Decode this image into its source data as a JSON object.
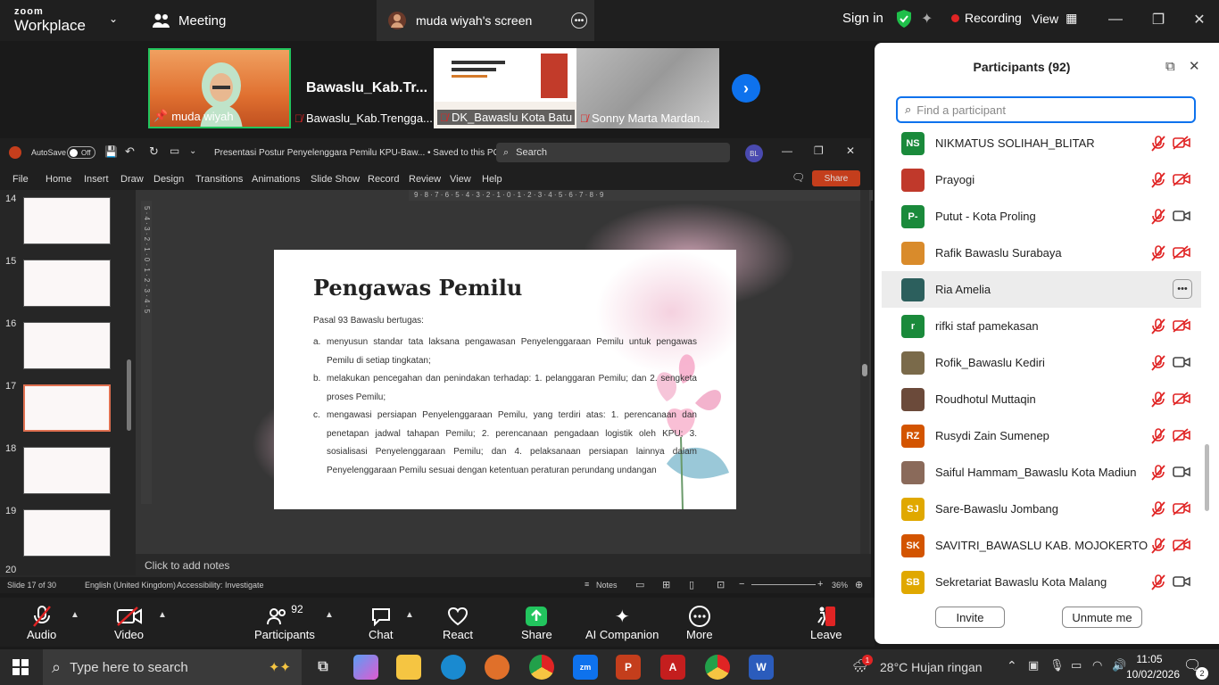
{
  "zoom": {
    "logo_top": "zoom",
    "logo_bottom": "Workplace",
    "meeting_tab": "Meeting",
    "screen_tab": "muda wiyah's screen",
    "sign_in": "Sign in",
    "recording": "Recording",
    "view": "View"
  },
  "video_tiles": [
    {
      "name": "muda wiyah"
    },
    {
      "name": "Bawaslu_Kab.Trengga...",
      "display_title": "Bawaslu_Kab.Tr..."
    },
    {
      "name": "DK_Bawaslu Kota Batu"
    },
    {
      "name": "Sonny Marta Mardan..."
    }
  ],
  "ppt": {
    "autosave_label": "AutoSave",
    "autosave_state": "Off",
    "title": "Presentasi Postur Penyelenggara Pemilu KPU-Baw... • Saved to this PC",
    "search_placeholder": "Search",
    "user_initials": "BL",
    "share_label": "Share",
    "menu": [
      "File",
      "Home",
      "Insert",
      "Draw",
      "Design",
      "Transitions",
      "Animations",
      "Slide Show",
      "Record",
      "Review",
      "View",
      "Help"
    ],
    "thumb_numbers": [
      "14",
      "15",
      "16",
      "17",
      "18",
      "19",
      "20"
    ],
    "ruler_top": "9 · 8 · 7 · 6 · 5 · 4 · 3 · 2 · 1 · 0 · 1 · 2 · 3 · 4 · 5 · 6 · 7 · 8 · 9",
    "ruler_left": "5 · 4 · 3 · 2 · 1 · 0 · 1 · 2 · 3 · 4 · 5",
    "notes_placeholder": "Click to add notes",
    "status_slide": "Slide 17 of 30",
    "status_lang": "English (United Kingdom)",
    "status_access": "Accessibility: Investigate",
    "status_notes": "Notes",
    "status_zoom": "36%"
  },
  "slide": {
    "title": "Pengawas Pemilu",
    "intro": "Pasal 93 Bawaslu bertugas:",
    "items": [
      {
        "marker": "a.",
        "text": "menyusun standar tata laksana pengawasan Penyelenggaraan Pemilu untuk pengawas Pemilu di setiap tingkatan;"
      },
      {
        "marker": "b.",
        "text": "melakukan pencegahan dan penindakan terhadap: 1. pelanggaran Pemilu; dan 2. sengketa proses Pemilu;"
      },
      {
        "marker": "c.",
        "text": "mengawasi persiapan Penyelenggaraan Pemilu, yang terdiri atas: 1. perencanaan dan penetapan jadwal tahapan Pemilu; 2. perencanaan pengadaan logistik oleh KPU; 3. sosialisasi Penyelenggaraan Pemilu; dan 4. pelaksanaan persiapan lainnya dalam Penyelenggaraan Pemilu sesuai dengan ketentuan peraturan perundang undangan"
      }
    ]
  },
  "participants": {
    "title": "Participants (92)",
    "search_placeholder": "Find a participant",
    "list": [
      {
        "name": "NIKMATUS SOLIHAH_BLITAR",
        "initials": "NS",
        "color": "#1a8a3b",
        "video": false
      },
      {
        "name": "Prayogi",
        "initials": "",
        "color": "#c0392b",
        "video": false
      },
      {
        "name": "Putut - Kota Proling",
        "initials": "P-",
        "color": "#1a8a3b",
        "video": true
      },
      {
        "name": "Rafik Bawaslu Surabaya",
        "initials": "",
        "color": "#d98b2b",
        "video": false
      },
      {
        "name": "Ria Amelia",
        "initials": "",
        "color": "#2c5f5d",
        "video": true
      },
      {
        "name": "rifki staf pamekasan",
        "initials": "r",
        "color": "#1a8a3b",
        "video": false
      },
      {
        "name": "Rofik_Bawaslu Kediri",
        "initials": "",
        "color": "#7a6a4a",
        "video": true
      },
      {
        "name": "Roudhotul Muttaqin",
        "initials": "",
        "color": "#6b4a3a",
        "video": false
      },
      {
        "name": "Rusydi Zain Sumenep",
        "initials": "RZ",
        "color": "#d35400",
        "video": false
      },
      {
        "name": "Saiful Hammam_Bawaslu Kota Madiun",
        "initials": "",
        "color": "#8a6a5a",
        "video": true
      },
      {
        "name": "Sare-Bawaslu Jombang",
        "initials": "SJ",
        "color": "#e0a800",
        "video": false
      },
      {
        "name": "SAVITRI_BAWASLU KAB. MOJOKERTO",
        "initials": "SK",
        "color": "#d35400",
        "video": false
      },
      {
        "name": "Sekretariat Bawaslu Kota Malang",
        "initials": "SB",
        "color": "#e0a800",
        "video": true
      }
    ],
    "invite": "Invite",
    "unmute_me": "Unmute me"
  },
  "toolbar": {
    "audio": "Audio",
    "video": "Video",
    "participants": "Participants",
    "participants_count": "92",
    "chat": "Chat",
    "react": "React",
    "share": "Share",
    "ai": "AI Companion",
    "more": "More",
    "leave": "Leave"
  },
  "taskbar": {
    "search_placeholder": "Type here to search",
    "weather": "28°C  Hujan ringan",
    "time": "11:05",
    "date": "10/02/2026",
    "notif_count": "2",
    "weather_badge": "1"
  }
}
